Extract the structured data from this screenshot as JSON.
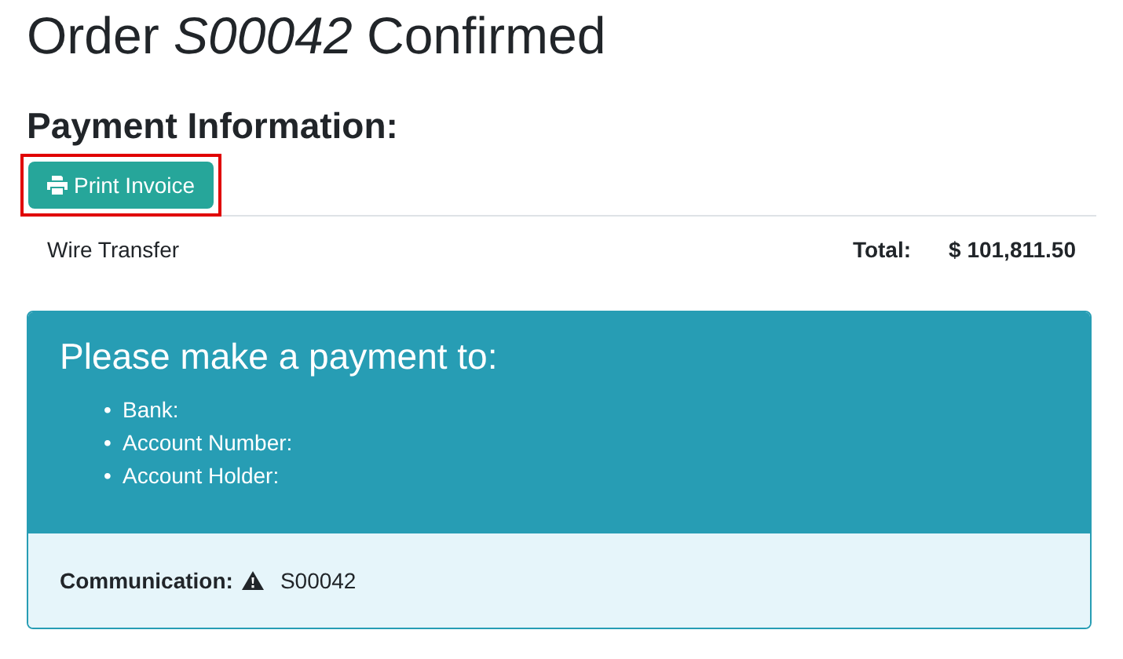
{
  "title": "Order *S00042* Confirmed",
  "payment_heading": "Payment Information:",
  "print_button": {
    "label": "Print Invoice",
    "highlighted": true
  },
  "payment_row": {
    "method": "Wire Transfer",
    "total_label": "Total:",
    "total_value": "$ 101,811.50"
  },
  "payment_card": {
    "heading": "Please make a payment to:",
    "items": [
      {
        "bullet": "•",
        "text": "Bank:"
      },
      {
        "bullet": "•",
        "text": "Account Number:"
      },
      {
        "bullet": "•",
        "text": "Account Holder:"
      }
    ],
    "communication_label": "Communication:",
    "communication_value": "S00042"
  }
}
